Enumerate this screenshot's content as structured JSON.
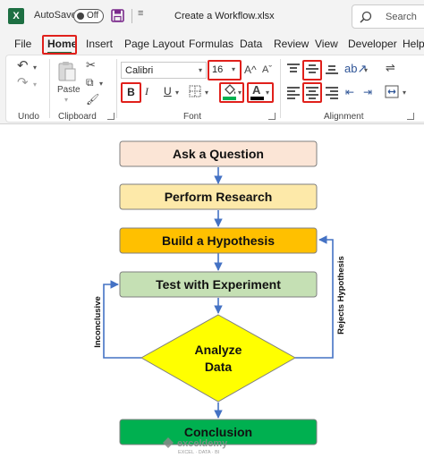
{
  "titlebar": {
    "logo_letter": "X",
    "autosave_label": "AutoSave",
    "autosave_state": "Off",
    "qat_more": "≡",
    "file_title": "Create a Workflow.xlsx",
    "search_label": "Search"
  },
  "tabs": [
    {
      "label": "File",
      "active": false
    },
    {
      "label": "Home",
      "active": true
    },
    {
      "label": "Insert",
      "active": false
    },
    {
      "label": "Page Layout",
      "active": false
    },
    {
      "label": "Formulas",
      "active": false
    },
    {
      "label": "Data",
      "active": false
    },
    {
      "label": "Review",
      "active": false
    },
    {
      "label": "View",
      "active": false
    },
    {
      "label": "Developer",
      "active": false
    },
    {
      "label": "Help",
      "active": false
    }
  ],
  "ribbon": {
    "undo_label": "Undo",
    "clipboard_label": "Clipboard",
    "paste_label": "Paste",
    "font_label": "Font",
    "alignment_label": "Alignment",
    "font_name": "Calibri",
    "font_size": "16",
    "bold_label": "B",
    "italic_label": "I",
    "underline_label": "U",
    "font_color_label": "A",
    "grow_font_label": "A^",
    "shrink_font_label": "Aˇ",
    "fill_color": "#00b050",
    "font_color": "#000000"
  },
  "flowchart": {
    "steps": [
      {
        "label": "Ask a Question",
        "color": "#fbe5d6"
      },
      {
        "label": "Perform Research",
        "color": "#fde9a9"
      },
      {
        "label": "Build a Hypothesis",
        "color": "#ffc000"
      },
      {
        "label": "Test with Experiment",
        "color": "#c5e0b4"
      }
    ],
    "decision": {
      "line1": "Analyze",
      "line2": "Data",
      "color": "#ffff00"
    },
    "conclusion": {
      "label": "Conclusion",
      "color": "#00b050"
    },
    "left_loop_label": "Inconclusive",
    "right_loop_label": "Rejects Hypothesis",
    "arrow_color": "#4472c4"
  },
  "watermark": {
    "name": "exceldemy",
    "tagline": "EXCEL · DATA · BI"
  }
}
